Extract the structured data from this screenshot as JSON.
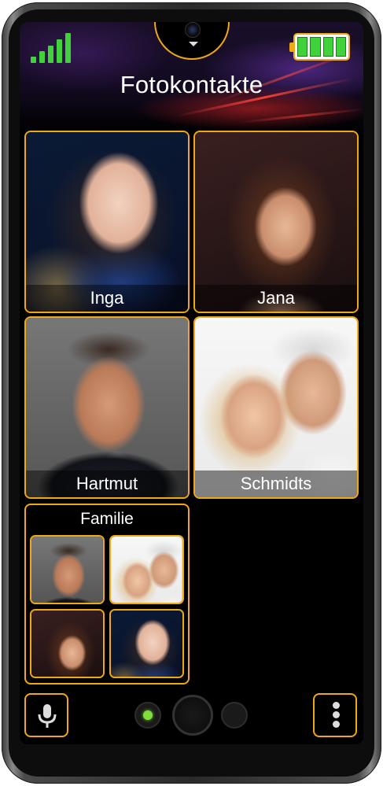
{
  "header": {
    "title": "Fotokontakte"
  },
  "status": {
    "signal_bars": 5,
    "battery_cells": 4
  },
  "contacts": [
    {
      "name": "Inga"
    },
    {
      "name": "Jana"
    },
    {
      "name": "Hartmut"
    },
    {
      "name": "Schmidts"
    }
  ],
  "group": {
    "name": "Familie"
  },
  "colors": {
    "accent": "#f0a814",
    "signal": "#3fd23a",
    "led": "#7fe03a"
  },
  "icons": {
    "mic": "microphone-icon",
    "menu": "more-vertical-icon"
  }
}
